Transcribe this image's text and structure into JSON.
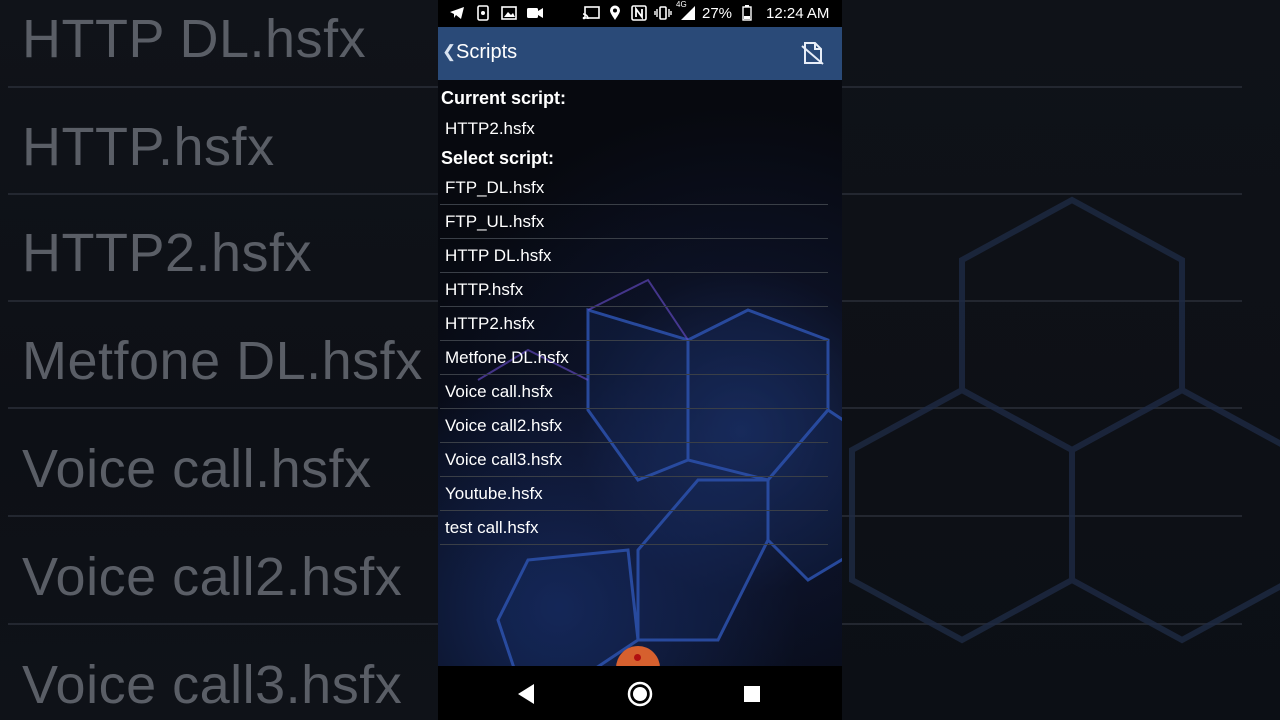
{
  "background_list": [
    "HTTP DL.hsfx",
    "HTTP.hsfx",
    "HTTP2.hsfx",
    "Metfone DL.hsfx",
    "Voice call.hsfx",
    "Voice call2.hsfx",
    "Voice call3.hsfx"
  ],
  "status_bar": {
    "battery": "27%",
    "time": "12:24 AM",
    "network": "4G"
  },
  "app_bar": {
    "title": "Scripts",
    "action_icon": "edit-script-icon"
  },
  "current_script": {
    "label": "Current script:",
    "value": "HTTP2.hsfx"
  },
  "select_script": {
    "label": "Select script:",
    "items": [
      "FTP_DL.hsfx",
      "FTP_UL.hsfx",
      "HTTP DL.hsfx",
      "HTTP.hsfx",
      "HTTP2.hsfx",
      "Metfone DL.hsfx",
      "Voice call.hsfx",
      "Voice call2.hsfx",
      "Voice call3.hsfx",
      "Youtube.hsfx",
      "test call.hsfx"
    ]
  },
  "colors": {
    "app_bar": "#2a4a78",
    "status_bar": "#000000",
    "fab": "#d6602e"
  },
  "nav_bar": {
    "back_icon": "back-triangle-icon",
    "home_icon": "home-circle-icon",
    "recents_icon": "recents-square-icon"
  }
}
